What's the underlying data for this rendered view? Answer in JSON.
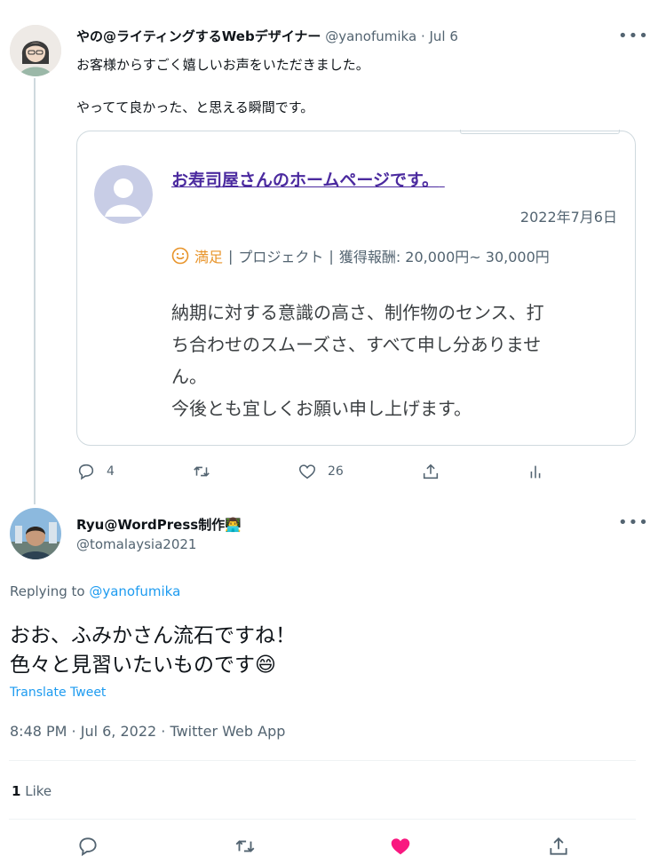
{
  "tweet": {
    "author_name": "やの@ライティングするWebデザイナー",
    "author_handle": "@yanofumika",
    "date": "· Jul 6",
    "text_line1": "お客様からすごく嬉しいお声をいただきました。",
    "text_line2": "やってて良かった、と思える瞬間です。",
    "card": {
      "title": "お寿司屋さんのホームページです。",
      "date": "2022年7月6日",
      "rating_label": "満足",
      "category": "プロジェクト",
      "reward": "獲得報酬: 20,000円~ 30,000円",
      "body_line1": "納期に対する意識の高さ、制作物のセンス、打",
      "body_line2": "ち合わせのスムーズさ、すべて申し分ありませ",
      "body_line3": "ん。",
      "body_line4": "今後とも宜しくお願い申し上げます。"
    },
    "actions": {
      "reply_count": "4",
      "retweet_count": "",
      "like_count": "26"
    }
  },
  "reply": {
    "author_name": "Ryu@WordPress制作",
    "author_emoji": "👨‍💻",
    "author_handle": "@tomalaysia2021",
    "replying_prefix": "Replying to",
    "replying_handle": "@yanofumika",
    "text_line1": "おお、ふみかさん流石ですね！",
    "text_line2": "色々と見習いたいものです",
    "text_emoji": "😄",
    "translate": "Translate Tweet",
    "timestamp": "8:48 PM · Jul 6, 2022 · Twitter Web App",
    "likes_count": "1",
    "likes_label": "Like"
  },
  "colors": {
    "accent": "#1d9bf0",
    "like_active": "#f91880",
    "card_title": "#4b2a9f",
    "rating": "#e8942a"
  }
}
